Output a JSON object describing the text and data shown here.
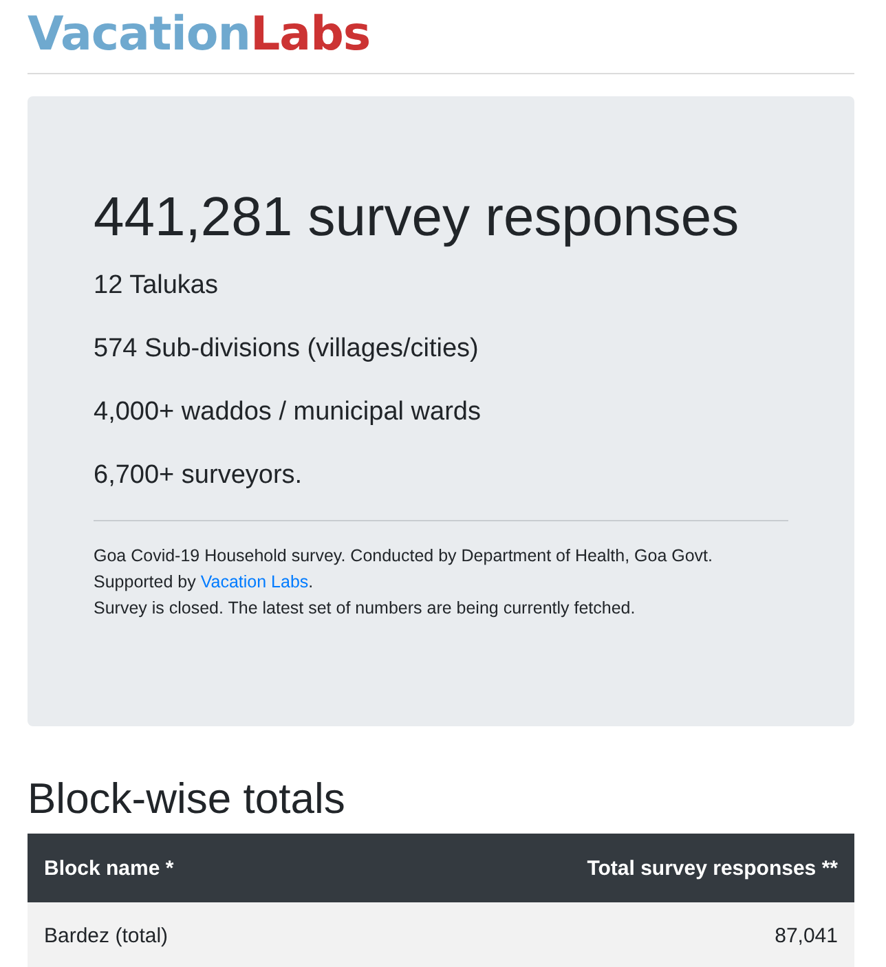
{
  "logo": {
    "first": "Vacation",
    "second": "Labs"
  },
  "summary": {
    "headline": "441,281 survey responses",
    "stats": [
      "12 Talukas",
      "574 Sub-divisions (villages/cities)",
      "4,000+ waddos / municipal wards",
      "6,700+ surveyors."
    ],
    "note": {
      "line_1": "Goa Covid-19 Household survey. Conducted by Department of Health, Goa Govt.",
      "line_2_prefix": "Supported by",
      "link": "Vacation Labs",
      "line_2_suffix": ".",
      "line_3": "Survey is closed. The latest set of numbers are being currently fetched."
    }
  },
  "section_title": "Block-wise totals",
  "table": {
    "columns": [
      "Block name *",
      "Total survey responses **"
    ],
    "rows": [
      {
        "cells": [
          "Bardez (total)",
          "87,041"
        ]
      }
    ]
  }
}
